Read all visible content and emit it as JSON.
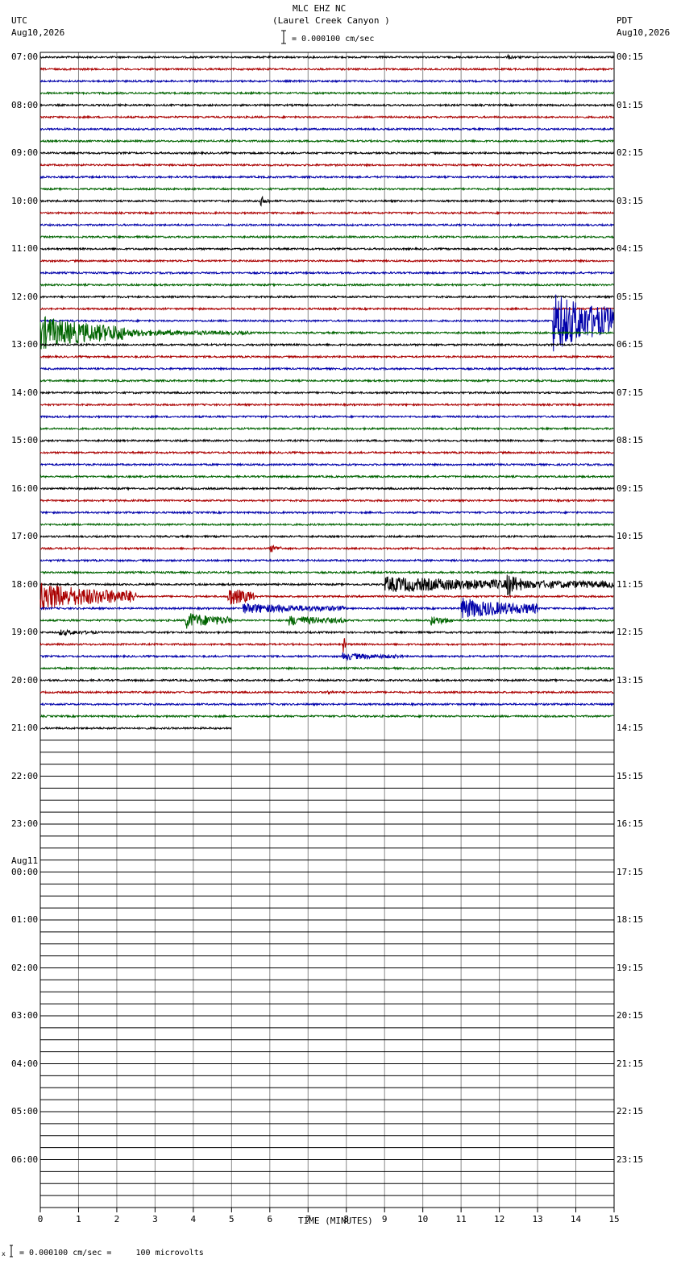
{
  "header": {
    "station": "MLC EHZ NC",
    "location": "(Laurel Creek Canyon )",
    "scale": "= 0.000100 cm/sec",
    "left_tz": "UTC",
    "left_date": "Aug10,2026",
    "right_tz": "PDT",
    "right_date": "Aug10,2026"
  },
  "footer": {
    "scale_note": "= 0.000100 cm/sec =     100 microvolts",
    "prefix": "x"
  },
  "chart_data": {
    "type": "line",
    "title": "MLC EHZ NC (Laurel Creek Canyon )",
    "xlabel": "TIME (MINUTES)",
    "xlim": [
      0,
      15
    ],
    "x_ticks": [
      "0",
      "1",
      "2",
      "3",
      "4",
      "5",
      "6",
      "7",
      "8",
      "9",
      "10",
      "11",
      "12",
      "13",
      "14",
      "15"
    ],
    "traces_per_hour": 4,
    "trace_minutes": 15,
    "trace_colors": [
      "#000000",
      "#aa0000",
      "#0000aa",
      "#006400"
    ],
    "left_labels": [
      "07:00",
      "08:00",
      "09:00",
      "10:00",
      "11:00",
      "12:00",
      "13:00",
      "14:00",
      "15:00",
      "16:00",
      "17:00",
      "18:00",
      "19:00",
      "20:00",
      "21:00",
      "22:00",
      "23:00",
      "00:00",
      "01:00",
      "02:00",
      "03:00",
      "04:00",
      "05:00",
      "06:00"
    ],
    "left_date_change": {
      "hour_index": 17,
      "label": "Aug11"
    },
    "right_labels": [
      "00:15",
      "01:15",
      "02:15",
      "03:15",
      "04:15",
      "05:15",
      "06:15",
      "07:15",
      "08:15",
      "09:15",
      "10:15",
      "11:15",
      "12:15",
      "13:15",
      "14:15",
      "15:15",
      "16:15",
      "17:15",
      "18:15",
      "19:15",
      "20:15",
      "21:15",
      "22:15",
      "23:15"
    ],
    "filled_traces": 57,
    "last_trace_minutes": 5,
    "events": [
      {
        "trace": 0,
        "start": 12.2,
        "end": 12.6,
        "amp": 3
      },
      {
        "trace": 12,
        "start": 5.75,
        "end": 6.0,
        "amp": 7
      },
      {
        "trace": 22,
        "start": 13.4,
        "end": 15.0,
        "amp": 40
      },
      {
        "trace": 23,
        "start": 0.0,
        "end": 2.2,
        "amp": 22
      },
      {
        "trace": 23,
        "start": 2.2,
        "end": 5.5,
        "amp": 5
      },
      {
        "trace": 41,
        "start": 6.0,
        "end": 6.3,
        "amp": 6
      },
      {
        "trace": 44,
        "start": 9.0,
        "end": 15.0,
        "amp": 10
      },
      {
        "trace": 44,
        "start": 12.2,
        "end": 12.6,
        "amp": 18
      },
      {
        "trace": 45,
        "start": 0.0,
        "end": 2.5,
        "amp": 18
      },
      {
        "trace": 45,
        "start": 4.9,
        "end": 5.6,
        "amp": 14
      },
      {
        "trace": 46,
        "start": 5.3,
        "end": 8.0,
        "amp": 7
      },
      {
        "trace": 46,
        "start": 11.0,
        "end": 13.0,
        "amp": 14
      },
      {
        "trace": 47,
        "start": 3.8,
        "end": 5.0,
        "amp": 11
      },
      {
        "trace": 47,
        "start": 6.5,
        "end": 8.0,
        "amp": 7
      },
      {
        "trace": 47,
        "start": 10.2,
        "end": 10.8,
        "amp": 7
      },
      {
        "trace": 48,
        "start": 0.5,
        "end": 1.5,
        "amp": 4
      },
      {
        "trace": 49,
        "start": 7.9,
        "end": 8.0,
        "amp": 14
      },
      {
        "trace": 50,
        "start": 7.9,
        "end": 9.5,
        "amp": 5
      },
      {
        "trace": 53,
        "start": 7.5,
        "end": 7.7,
        "amp": 4
      }
    ]
  }
}
